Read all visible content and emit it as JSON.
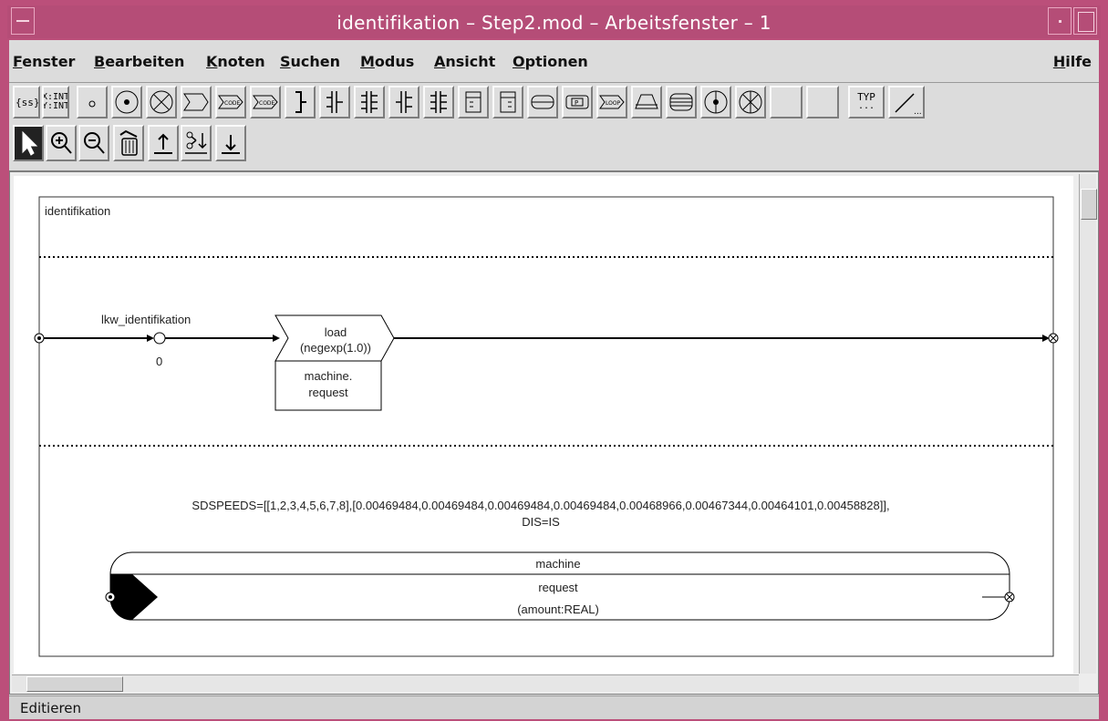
{
  "window": {
    "title": "identifikation – Step2.mod – Arbeitsfenster – 1"
  },
  "menubar": {
    "items": [
      {
        "label": "Fenster",
        "key": "F"
      },
      {
        "label": "Bearbeiten",
        "key": "B"
      },
      {
        "label": "Knoten",
        "key": "K"
      },
      {
        "label": "Suchen",
        "key": "S"
      },
      {
        "label": "Modus",
        "key": "M"
      },
      {
        "label": "Ansicht",
        "key": "A"
      },
      {
        "label": "Optionen",
        "key": "O"
      }
    ],
    "help": {
      "label": "Hilfe",
      "key": "H"
    }
  },
  "toolbar": {
    "row1_icons": [
      "choice-icon",
      "type-declaration-icon",
      "small-node-icon",
      "place-icon",
      "cross-place-icon",
      "process-icon",
      "code-process-icon",
      "bracket-icon",
      "split-1-icon",
      "split-2-icon",
      "split-3-icon",
      "split-4-icon",
      "table-1-icon",
      "table-2-icon",
      "queue-icon",
      "parameter-queue-icon",
      "loop-icon",
      "trapezoid-icon",
      "stack-icon",
      "circle-dot-icon",
      "circle-cross-icon",
      "blank-1-icon",
      "blank-2-icon",
      "type-icon",
      "line-icon"
    ],
    "xint": "X:INT",
    "yint": "Y:INT",
    "type_label": "TYP",
    "row2_icons": [
      "select-arrow-icon",
      "zoom-in-icon",
      "zoom-out-icon",
      "trash-icon",
      "upload-icon",
      "cut-icon",
      "download-icon"
    ]
  },
  "diagram": {
    "frame_title": "identifikation",
    "entry_label": "lkw_identifikation",
    "entry_count": "0",
    "process_top": [
      "load",
      "(negexp(1.0))"
    ],
    "process_bottom": [
      "machine.",
      "request"
    ],
    "sdspeeds_line1": "SDSPEEDS=[[1,2,3,4,5,6,7,8],[0.00469484,0.00469484,0.00469484,0.00469484,0.00468966,0.00467344,0.00464101,0.00458828]],",
    "sdspeeds_line2": "DIS=IS",
    "resource_name": "machine",
    "resource_func": "request",
    "resource_param": "(amount:REAL)"
  },
  "status": {
    "text": "Editieren"
  },
  "colors": {
    "titlebar": "#bb4f7a",
    "client": "#dcdcdc",
    "canvas": "#ffffff"
  }
}
